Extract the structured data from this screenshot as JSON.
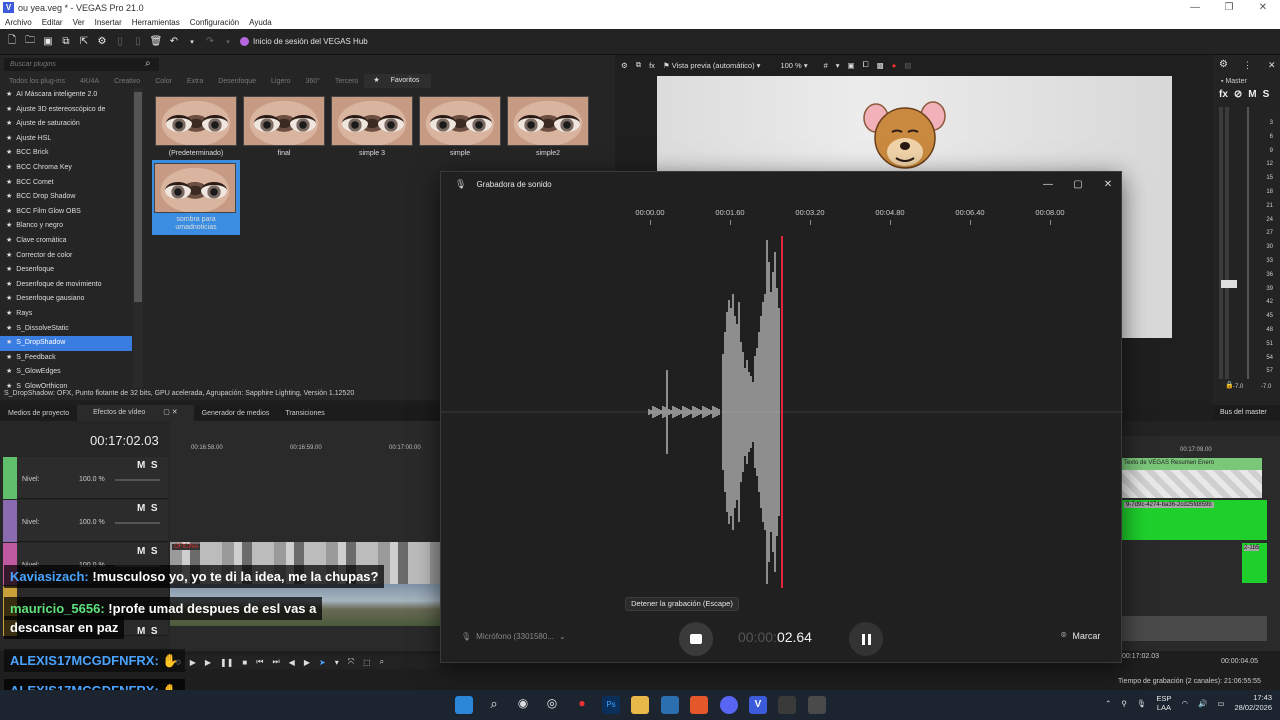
{
  "window": {
    "title": "ou yea.veg * - VEGAS Pro 21.0",
    "logo_letter": "V",
    "buttons": [
      "—",
      "❐",
      "✕"
    ]
  },
  "menu": [
    "Archivo",
    "Editar",
    "Ver",
    "Insertar",
    "Herramientas",
    "Configuración",
    "Ayuda"
  ],
  "toolbar": {
    "hub_label": "Inicio de sesión del VEGAS Hub"
  },
  "plugins": {
    "search_placeholder": "Buscar plugins",
    "categories": [
      "Todos los plug-ins",
      "4K/4A",
      "Creativo",
      "Color",
      "Extra",
      "Desenfoque",
      "Ligero",
      "360°",
      "Tercero",
      "Favoritos"
    ],
    "items": [
      "AI Máscara inteligente 2.0",
      "Ajuste 3D estereoscópico de",
      "Ajuste de saturación",
      "Ajuste HSL",
      "BCC Brick",
      "BCC Chroma Key",
      "BCC Comet",
      "BCC Drop Shadow",
      "BCC Film Glow OBS",
      "Blanco y negro",
      "Clave cromática",
      "Corrector de color",
      "Desenfoque",
      "Desenfoque de movimiento",
      "Desenfoque gausiano",
      "Rays",
      "S_DissolveStatic",
      "S_DropShadow",
      "S_Feedback",
      "S_GlowEdges",
      "S_GlowOrthicon"
    ],
    "selected_item": "S_DropShadow",
    "presets": [
      "(Predeterminado)",
      "final",
      "simple 3",
      "simple",
      "simple2",
      "sombra para umadnoticias"
    ],
    "status": "S_DropShadow: OFX, Punto flotante de 32 bits, GPU acelerada, Agrupación: Sapphire Lighting, Versión 1.12520"
  },
  "preview": {
    "mode": "Vista previa (automático)",
    "zoom": "100 %"
  },
  "master": {
    "label": "Master",
    "fx": "fx",
    "m": "M",
    "s": "S",
    "db_scale": [
      "3",
      "6",
      "9",
      "12",
      "15",
      "18",
      "21",
      "24",
      "27",
      "30",
      "33",
      "36",
      "39",
      "42",
      "45",
      "48",
      "51",
      "54",
      "57"
    ],
    "level_left": "-7.0",
    "level_right": "-7.0",
    "footer": "Bus del master"
  },
  "lower_tabs": [
    "Medios de proyecto",
    "Efectos de vídeo",
    "Generador de medios",
    "Transiciones"
  ],
  "timeline": {
    "timecode": "00:17:02.03",
    "ruler": [
      "00:16:58.00",
      "00:16:59.00",
      "00:17:00.00"
    ],
    "ruler_right": "00:17:08.00",
    "tracks": [
      {
        "m": "M",
        "s": "S",
        "level_label": "Nivel:",
        "level": "100.0 %",
        "color": "#5fbf6a"
      },
      {
        "m": "M",
        "s": "S",
        "level_label": "Nivel:",
        "level": "100.0 %",
        "color": "#8a6ab0"
      },
      {
        "m": "M",
        "s": "S",
        "level_label": "Nivel:",
        "level": "100.0 %",
        "color": "#c05aa0"
      }
    ],
    "clip_texto": "Texto de VEGAS Resumen Enero",
    "clip_green": "9-7d9c-4274-ba36-2cd25fd859b",
    "clip_oficina": "OFICINA",
    "clip_small": "2-1b5",
    "rec_time_status": "Tiempo de grabación (2 canales): 21:06:55:55",
    "right_tc1": "00:17:02.03",
    "right_tc2": "00:00:04.05"
  },
  "chat": [
    {
      "user": "Kaviasizach:",
      "text": "!musculoso yo, yo te di la idea, me la chupas?",
      "color": "blue"
    },
    {
      "user": "mauricio_5656:",
      "text": "!profe umad despues de esl vas a",
      "color": "green"
    },
    {
      "user": "",
      "text": "descansar en paz",
      "color": "green"
    },
    {
      "user": "ALEXIS17MCGDFNFRX:",
      "text": "",
      "color": "blue"
    },
    {
      "user": "ALEXIS17MCGDFNFRX:",
      "text": "",
      "color": "blue"
    }
  ],
  "recorder": {
    "title": "Grabadora de sonido",
    "ticks": [
      "00:00.00",
      "00:01.60",
      "00:03.20",
      "00:04.80",
      "00:06.40",
      "00:08.00"
    ],
    "tooltip": "Detener la grabación (Escape)",
    "mic": "Micrófono (3301580...",
    "elapsed_dim": "00:00:",
    "elapsed": "02.64",
    "mark": "Marcar",
    "playhead_color": "#e0243c"
  },
  "taskbar": {
    "lang": "ESP",
    "lang2": "LAA",
    "time": "17:43",
    "date": "28/02/2026"
  }
}
